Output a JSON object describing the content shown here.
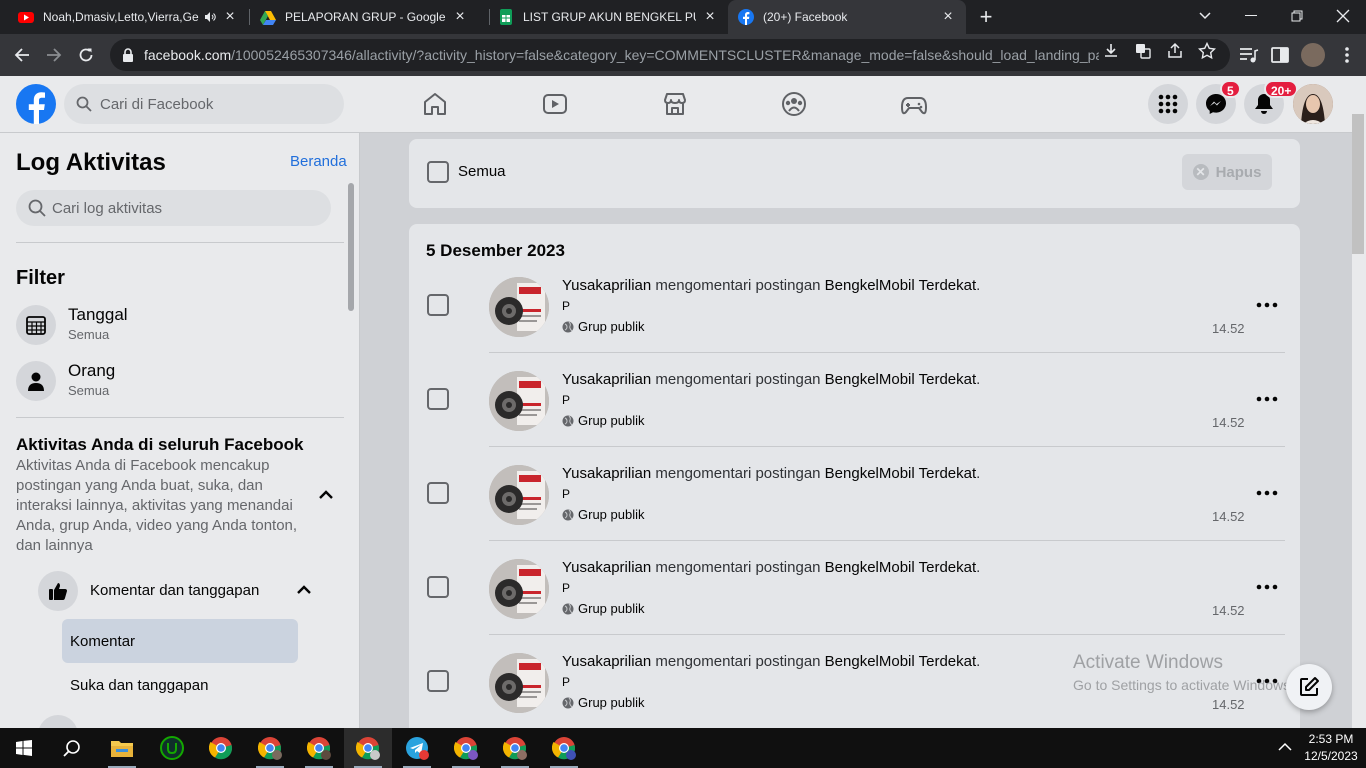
{
  "browser": {
    "tabs": [
      {
        "title": "Noah,Dmasiv,Letto,Vierra,Ge",
        "icon": "youtube-icon"
      },
      {
        "title": "PELAPORAN GRUP - Google Dri",
        "icon": "google-drive-icon"
      },
      {
        "title": "LIST GRUP AKUN BENGKEL PUR",
        "icon": "google-sheets-icon"
      },
      {
        "title": "(20+) Facebook",
        "icon": "facebook-icon"
      }
    ],
    "url_domain": "facebook.com",
    "url_path": "/100052465307346/allactivity/?activity_history=false&category_key=COMMENTSCLUSTER&manage_mode=false&should_load_landing_pa..."
  },
  "fb": {
    "search_placeholder": "Cari di Facebook",
    "messenger_badge": "5",
    "notif_badge": "20+",
    "brand_color": "#1877f2"
  },
  "sidebar": {
    "title": "Log Aktivitas",
    "home_link": "Beranda",
    "search_placeholder": "Cari log aktivitas",
    "filter_heading": "Filter",
    "filters": [
      {
        "label": "Tanggal",
        "value": "Semua",
        "icon": "calendar-icon"
      },
      {
        "label": "Orang",
        "value": "Semua",
        "icon": "person-icon"
      }
    ],
    "activity_heading": "Aktivitas Anda di seluruh Facebook",
    "activity_desc": "Aktivitas Anda di Facebook mencakup postingan yang Anda buat, suka, dan interaksi lainnya, aktivitas yang menandai Anda, grup Anda, video yang Anda tonton, dan lainnya",
    "category": "Komentar dan tanggapan",
    "subitems": [
      "Komentar",
      "Suka dan tanggapan"
    ]
  },
  "main": {
    "select_all_label": "Semua",
    "delete_label": "Hapus",
    "date_heading": "5 Desember 2023",
    "entries": [
      {
        "actor": "Yusakaprilian",
        "verb": " mengomentari postingan ",
        "target": "BengkelMobil Terdekat",
        "end": ".",
        "comment": "P",
        "privacy": "Grup publik",
        "time": "14.52"
      },
      {
        "actor": "Yusakaprilian",
        "verb": " mengomentari postingan ",
        "target": "BengkelMobil Terdekat",
        "end": ".",
        "comment": "P",
        "privacy": "Grup publik",
        "time": "14.52"
      },
      {
        "actor": "Yusakaprilian",
        "verb": " mengomentari postingan ",
        "target": "BengkelMobil Terdekat",
        "end": ".",
        "comment": "P",
        "privacy": "Grup publik",
        "time": "14.52"
      },
      {
        "actor": "Yusakaprilian",
        "verb": " mengomentari postingan ",
        "target": "BengkelMobil Terdekat",
        "end": ".",
        "comment": "P",
        "privacy": "Grup publik",
        "time": "14.52"
      },
      {
        "actor": "Yusakaprilian",
        "verb": " mengomentari postingan ",
        "target": "BengkelMobil Terdekat",
        "end": ".",
        "comment": "P",
        "privacy": "Grup publik",
        "time": "14.52"
      }
    ]
  },
  "watermark": {
    "title": "Activate Windows",
    "subtitle": "Go to Settings to activate Windows."
  },
  "taskbar": {
    "time": "2:53 PM",
    "date": "12/5/2023"
  }
}
